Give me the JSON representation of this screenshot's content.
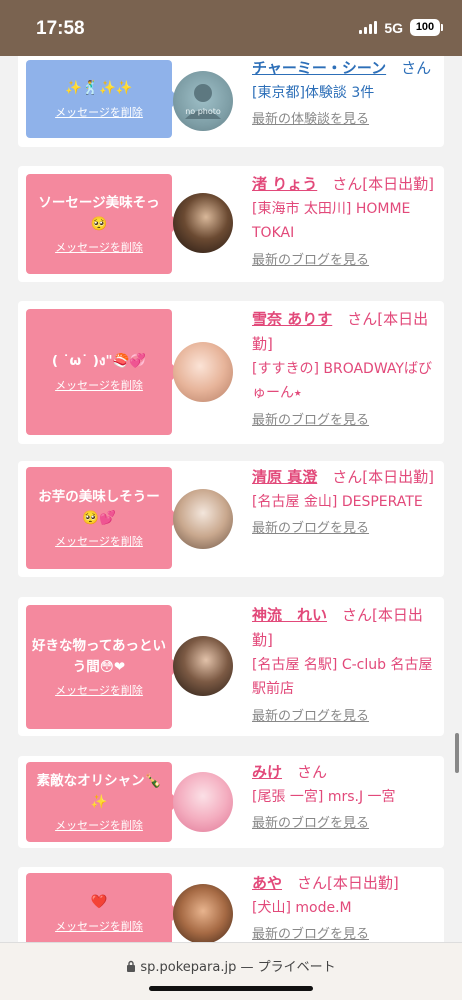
{
  "status": {
    "time": "17:58",
    "network": "5G",
    "battery": "100"
  },
  "cards": [
    {
      "theme": "blue",
      "message": "✨🕺✨✨",
      "delete_label": "メッセージを削除",
      "name": "チャーミー・シーン",
      "honorific": "さん",
      "status": "",
      "location": "[東京都]体験談 3件",
      "link": "最新の体験談を見る",
      "photo": "no photo"
    },
    {
      "theme": "pink",
      "message": "ソーセージ美味そっ🥺",
      "delete_label": "メッセージを削除",
      "name": "渚 りょう",
      "honorific": "さん",
      "status": "[本日出勤]",
      "location": "[東海市 太田川] HOMME TOKAI",
      "link": "最新のブログを見る"
    },
    {
      "theme": "pink",
      "message": "( ˙ω˙ )ง\"🍣💞",
      "delete_label": "メッセージを削除",
      "name": "雪奈 ありす",
      "honorific": "さん",
      "status": "[本日出勤]",
      "location": "[すすきの] BROADWAYばびゅーん⭑",
      "link": "最新のブログを見る"
    },
    {
      "theme": "pink",
      "message": "お芋の美味しそうー🥺💕",
      "delete_label": "メッセージを削除",
      "name": "清原 真澄",
      "honorific": "さん",
      "status": "[本日出勤]",
      "location": "[名古屋 金山] DESPERATE",
      "link": "最新のブログを見る"
    },
    {
      "theme": "pink",
      "message": "好きな物ってあっという間😳❤",
      "delete_label": "メッセージを削除",
      "name": "神流　れい",
      "honorific": "さん",
      "status": "[本日出勤]",
      "location": "[名古屋 名駅] C-club 名古屋駅前店",
      "link": "最新のブログを見る"
    },
    {
      "theme": "pink",
      "message": "素敵なオリシャン🍾✨",
      "delete_label": "メッセージを削除",
      "name": "みけ",
      "honorific": "さん",
      "status": "",
      "location": "[尾張 一宮] mrs.J 一宮",
      "link": "最新のブログを見る"
    },
    {
      "theme": "pink",
      "message": "❤️",
      "delete_label": "メッセージを削除",
      "name": "あや",
      "honorific": "さん",
      "status": "[本日出勤]",
      "location": "[犬山] mode.M",
      "link": "最新のブログを見る"
    }
  ],
  "browser": {
    "domain": "sp.pokepara.jp",
    "separator": "—",
    "mode": "プライベート"
  }
}
